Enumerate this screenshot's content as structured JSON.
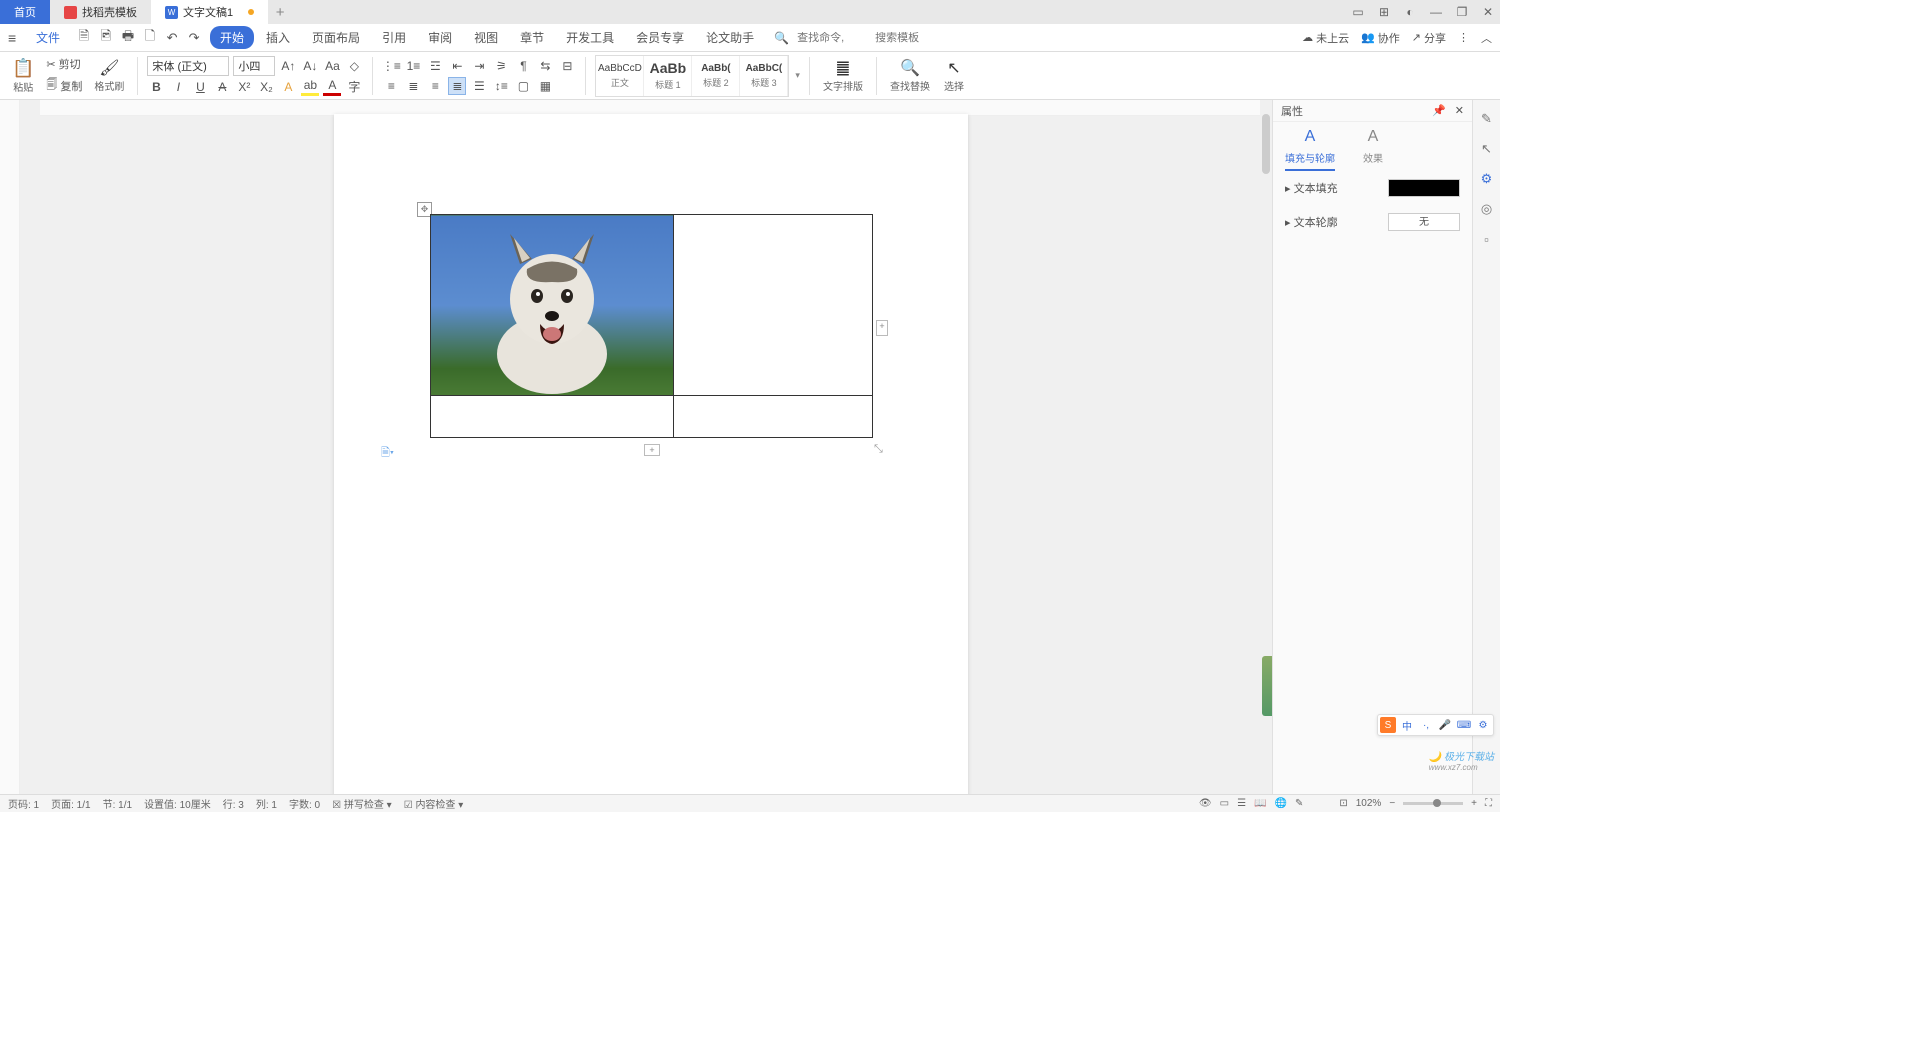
{
  "tabs": {
    "home": "首页",
    "template": "找稻壳模板",
    "doc": "文字文稿1"
  },
  "menu": {
    "file": "文件",
    "items": [
      "开始",
      "插入",
      "页面布局",
      "引用",
      "审阅",
      "视图",
      "章节",
      "开发工具",
      "会员专享",
      "论文助手"
    ],
    "search_cmd": "查找命令,",
    "search_tpl": "搜索模板"
  },
  "topright": {
    "cloud": "未上云",
    "coop": "协作",
    "share": "分享"
  },
  "ribbon": {
    "paste": "粘贴",
    "cut": "剪切",
    "copy": "复制",
    "format_painter": "格式刷",
    "font_name": "宋体 (正文)",
    "font_size": "小四",
    "styles": [
      {
        "preview": "AaBbCcD",
        "name": "正文"
      },
      {
        "preview": "AaBb",
        "name": "标题 1"
      },
      {
        "preview": "AaBb(",
        "name": "标题 2"
      },
      {
        "preview": "AaBbC(",
        "name": "标题 3"
      }
    ],
    "text_layout": "文字排版",
    "find_replace": "查找替换",
    "select": "选择"
  },
  "side": {
    "title": "属性",
    "tab_fill": "填充与轮廓",
    "tab_effect": "效果",
    "text_fill": "文本填充",
    "text_outline": "文本轮廓",
    "outline_val": "无"
  },
  "status": {
    "page_no": "页码: 1",
    "page": "页面: 1/1",
    "section": "节: 1/1",
    "setval": "设置值: 10厘米",
    "row": "行: 3",
    "col": "列: 1",
    "chars": "字数: 0",
    "spell": "拼写检查",
    "content": "内容检查",
    "zoom": "102%"
  },
  "ime": [
    "中",
    "·,",
    "🎤",
    "⌨",
    "⚙"
  ]
}
